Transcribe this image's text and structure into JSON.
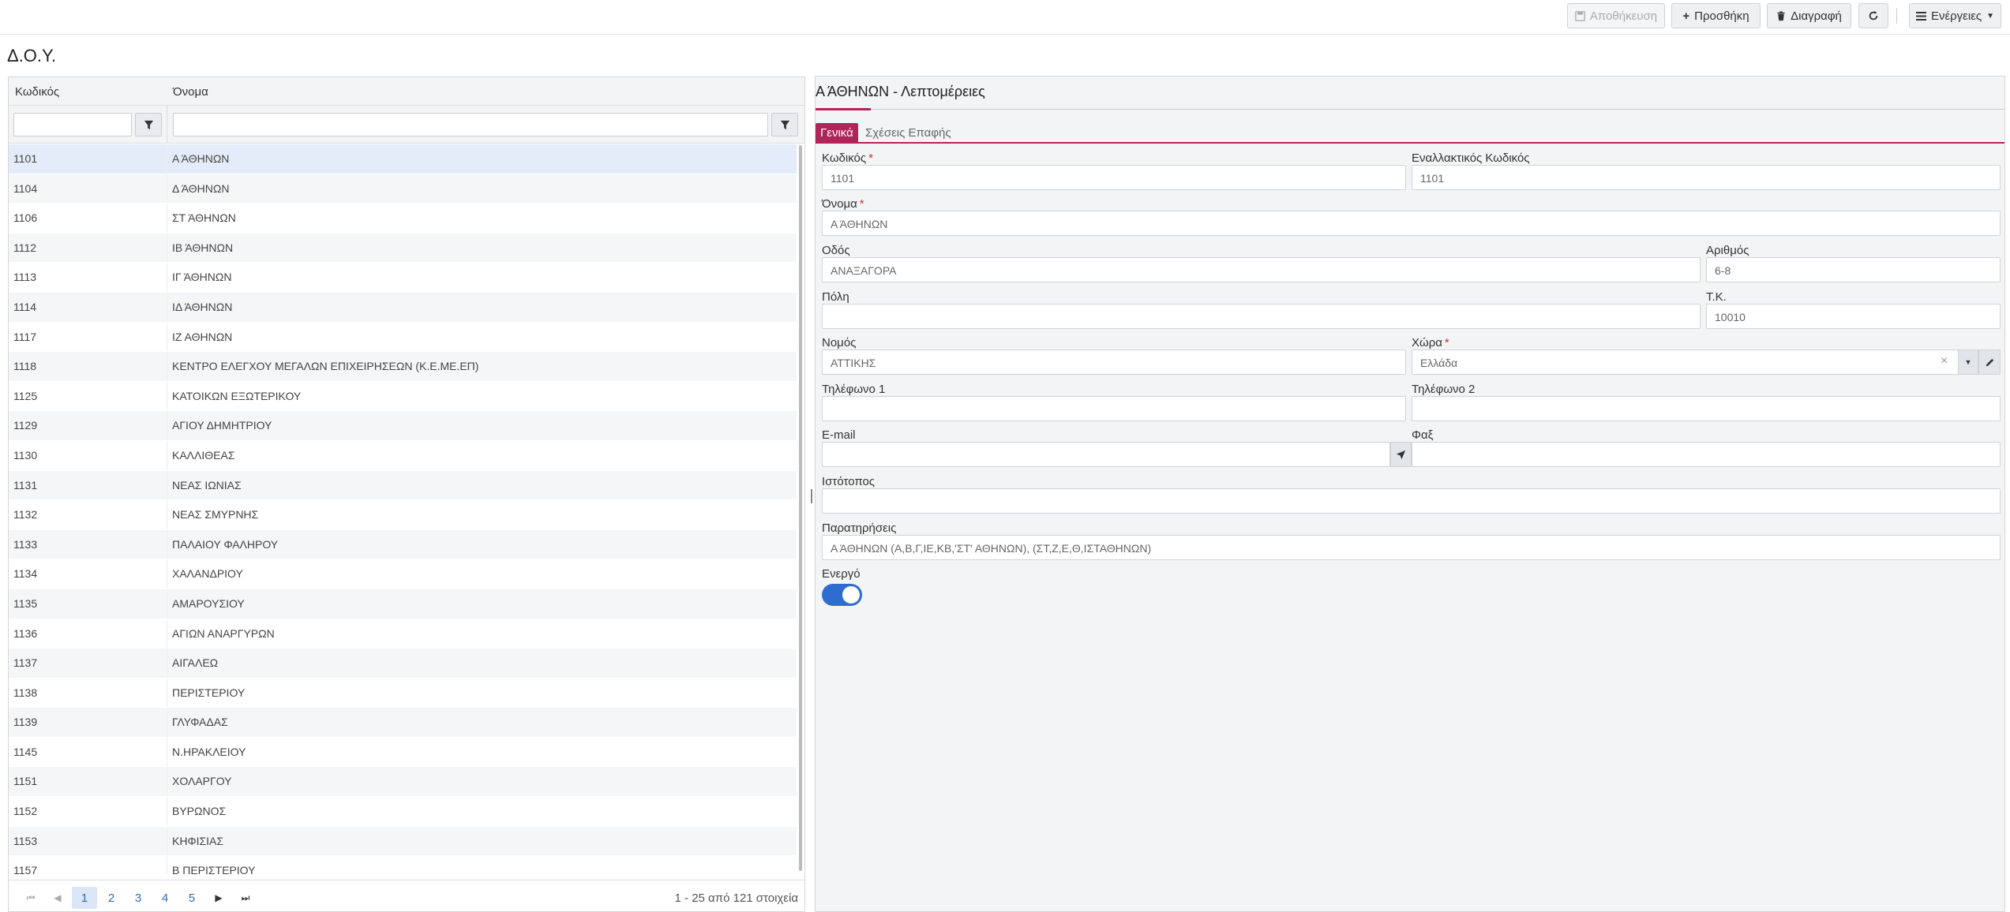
{
  "toolbar": {
    "save_label": "Αποθήκευση",
    "add_label": "Προσθήκη",
    "delete_label": "Διαγραφή",
    "actions_label": "Ενέργειες"
  },
  "page_title": "Δ.Ο.Υ.",
  "grid": {
    "columns": [
      "Κωδικός",
      "Όνομα"
    ],
    "rows": [
      {
        "code": "1101",
        "name": "Α ΆΘΗΝΩΝ"
      },
      {
        "code": "1104",
        "name": "Δ ΆΘΗΝΩΝ"
      },
      {
        "code": "1106",
        "name": "ΣΤ ΆΘΗΝΩΝ"
      },
      {
        "code": "1112",
        "name": "ΙΒ ΆΘΗΝΩΝ"
      },
      {
        "code": "1113",
        "name": "ΙΓ ΆΘΗΝΩΝ"
      },
      {
        "code": "1114",
        "name": "ΙΔ ΆΘΗΝΩΝ"
      },
      {
        "code": "1117",
        "name": "ΙΖ ΑΘΗΝΩΝ"
      },
      {
        "code": "1118",
        "name": "ΚΕΝΤΡΟ ΕΛΕΓΧΟΥ ΜΕΓΑΛΩΝ ΕΠΙΧΕΙΡΗΣΕΩΝ (Κ.Ε.ΜΕ.ΕΠ)"
      },
      {
        "code": "1125",
        "name": "ΚΑΤΟΙΚΩΝ ΕΞΩΤΕΡΙΚΟΥ"
      },
      {
        "code": "1129",
        "name": "ΑΓΙΟΥ ΔΗΜΗΤΡΙΟΥ"
      },
      {
        "code": "1130",
        "name": "ΚΑΛΛΙΘΕΑΣ"
      },
      {
        "code": "1131",
        "name": "ΝΕΑΣ ΙΩΝΙΑΣ"
      },
      {
        "code": "1132",
        "name": "ΝΕΑΣ ΣΜΥΡΝΗΣ"
      },
      {
        "code": "1133",
        "name": "ΠΑΛΑΙΟΥ ΦΑΛΗΡΟΥ"
      },
      {
        "code": "1134",
        "name": "ΧΑΛΑΝΔΡΙΟΥ"
      },
      {
        "code": "1135",
        "name": "ΑΜΑΡΟΥΣΙΟΥ"
      },
      {
        "code": "1136",
        "name": "ΑΓΙΩΝ ΑΝΑΡΓΥΡΩΝ"
      },
      {
        "code": "1137",
        "name": "ΑΙΓΑΛΕΩ"
      },
      {
        "code": "1138",
        "name": "ΠΕΡΙΣΤΕΡΙΟΥ"
      },
      {
        "code": "1139",
        "name": "ΓΛΥΦΑΔΑΣ"
      },
      {
        "code": "1145",
        "name": "Ν.ΗΡΑΚΛΕΙΟΥ"
      },
      {
        "code": "1151",
        "name": "ΧΟΛΑΡΓΟΥ"
      },
      {
        "code": "1152",
        "name": "ΒΥΡΩΝΟΣ"
      },
      {
        "code": "1153",
        "name": "ΚΗΦΙΣΙΑΣ"
      },
      {
        "code": "1157",
        "name": "Β ΠΕΡΙΣΤΕΡΙΟΥ"
      }
    ]
  },
  "pager": {
    "pages": [
      "1",
      "2",
      "3",
      "4",
      "5"
    ],
    "current": "1",
    "info": "1 - 25 από 121 στοιχεία"
  },
  "detail": {
    "title": "Α ΆΘΗΝΩΝ - Λεπτομέρειες",
    "tabs": [
      "Γενικά",
      "Σχέσεις Επαφής"
    ],
    "labels": {
      "code": "Κωδικός",
      "alt_code": "Εναλλακτικός Κωδικός",
      "name": "Όνομα",
      "street": "Οδός",
      "number": "Αριθμός",
      "city": "Πόλη",
      "zip": "Τ.Κ.",
      "prefecture": "Νομός",
      "country": "Χώρα",
      "phone1": "Τηλέφωνο 1",
      "phone2": "Τηλέφωνο 2",
      "email": "E-mail",
      "fax": "Φαξ",
      "website": "Ιστότοπος",
      "notes": "Παρατηρήσεις",
      "active": "Ενεργό"
    },
    "values": {
      "code": "1101",
      "alt_code": "1101",
      "name": "Α ΆΘΗΝΩΝ",
      "street": "ΑΝΑΞΑΓΟΡΑ",
      "number": "6-8",
      "city": "",
      "zip": "10010",
      "prefecture": "ΑΤΤΙΚΗΣ",
      "country": "Ελλάδα",
      "phone1": "",
      "phone2": "",
      "email": "",
      "fax": "",
      "website": "",
      "notes": "Α ΆΘΗΝΩΝ (Α,Β,Γ,ΙΕ,ΚΒ,'ΣΤ' ΑΘΗΝΩΝ),  (ΣΤ,Ζ,Ε,Θ,ΙΣΤΑΘΗΝΩΝ)",
      "active": true
    },
    "required_mark": "*"
  },
  "icons": {
    "save": "save-icon",
    "add": "plus-icon",
    "delete": "trash-icon",
    "refresh": "refresh-icon",
    "actions": "menu-icon",
    "filter": "filter-icon",
    "clear": "close-icon",
    "edit": "pencil-icon",
    "send": "send-icon"
  },
  "colors": {
    "accent": "#b0245a",
    "toggle": "#2f6cd0",
    "selected_row": "#e3ecf8",
    "link": "#2d6cb5"
  }
}
